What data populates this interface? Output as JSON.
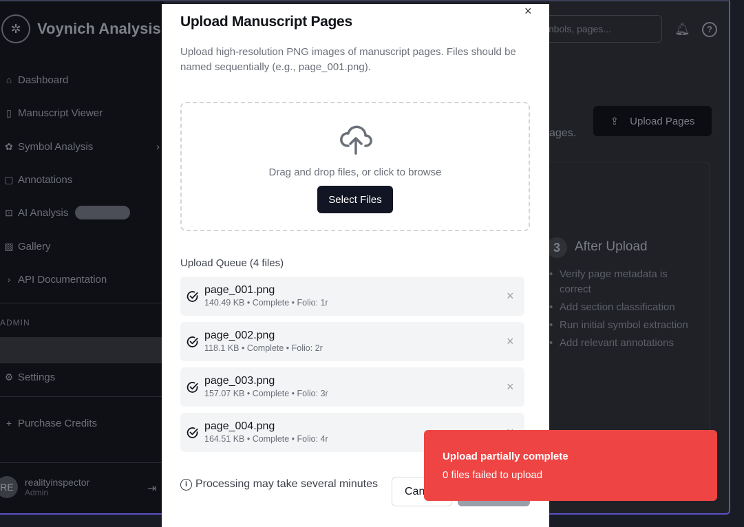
{
  "app": {
    "brand": "Voynich Analysis",
    "search_placeholder": "mbols, pages...",
    "upload_pages_label": "Upload Pages",
    "bg_subtitle_fragment": "ages.",
    "after_upload": {
      "number": "3",
      "title": "After Upload",
      "bullets": [
        "Verify page metadata is correct",
        "Add section classification",
        "Run initial symbol extraction",
        "Add relevant annotations"
      ]
    }
  },
  "sidebar": {
    "items": [
      {
        "label": "Dashboard",
        "icon": "home-icon"
      },
      {
        "label": "Manuscript Viewer",
        "icon": "book-icon"
      },
      {
        "label": "Symbol Analysis",
        "icon": "puzzle-icon"
      },
      {
        "label": "Annotations",
        "icon": "note-icon"
      },
      {
        "label": "AI Analysis",
        "icon": "bot-icon"
      },
      {
        "label": "Gallery",
        "icon": "image-icon"
      },
      {
        "label": "API Documentation",
        "icon": "chevron-right-icon"
      }
    ],
    "admin_label": "ADMIN",
    "settings_label": "Settings",
    "purchase_label": "Purchase Credits",
    "user": {
      "initials": "RE",
      "name": "realityinspector",
      "role": "Admin"
    }
  },
  "modal": {
    "title": "Upload Manuscript Pages",
    "description": "Upload high-resolution PNG images of manuscript pages. Files should be named sequentially (e.g., page_001.png).",
    "drop_text": "Drag and drop files, or click to browse",
    "select_files_label": "Select Files",
    "queue_label": "Upload Queue (4 files)",
    "queue": [
      {
        "name": "page_001.png",
        "meta": "140.49 KB • Complete • Folio: 1r"
      },
      {
        "name": "page_002.png",
        "meta": "118.1 KB • Complete • Folio: 2r"
      },
      {
        "name": "page_003.png",
        "meta": "157.07 KB • Complete • Folio: 3r"
      },
      {
        "name": "page_004.png",
        "meta": "164.51 KB • Complete • Folio: 4r"
      }
    ],
    "footer_note": "Processing may take several minutes",
    "cancel_label": "Cancel",
    "close_symbol": "×"
  },
  "toast": {
    "title": "Upload partially complete",
    "message": "0 files failed to upload",
    "color": "#ef4444"
  }
}
